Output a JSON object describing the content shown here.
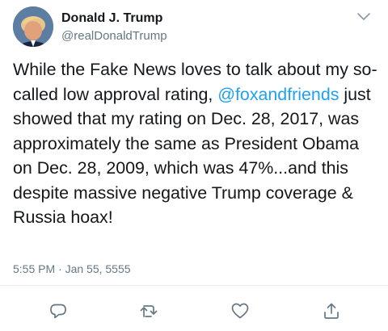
{
  "author": {
    "name": "Donald J. Trump",
    "handle": "@realDonaldTrump",
    "avatar_icon": "profile-photo"
  },
  "tweet": {
    "text_before": "While the Fake News loves to talk about my so-called low approval rating, ",
    "mention": "@foxandfriends",
    "text_after": " just showed that my rating on Dec. 28, 2017, was approximately the same as President Obama on Dec. 28, 2009, which was 47%...and this despite massive negative Trump coverage & Russia hoax!",
    "timestamp": "5:55 PM · Jan 55, 5555"
  },
  "actions": [
    {
      "icon": "reply-icon"
    },
    {
      "icon": "retweet-icon"
    },
    {
      "icon": "like-icon"
    },
    {
      "icon": "share-icon"
    }
  ],
  "colors": {
    "link": "#1da1f2",
    "secondary_text": "#657786",
    "primary_text": "#14171a"
  }
}
